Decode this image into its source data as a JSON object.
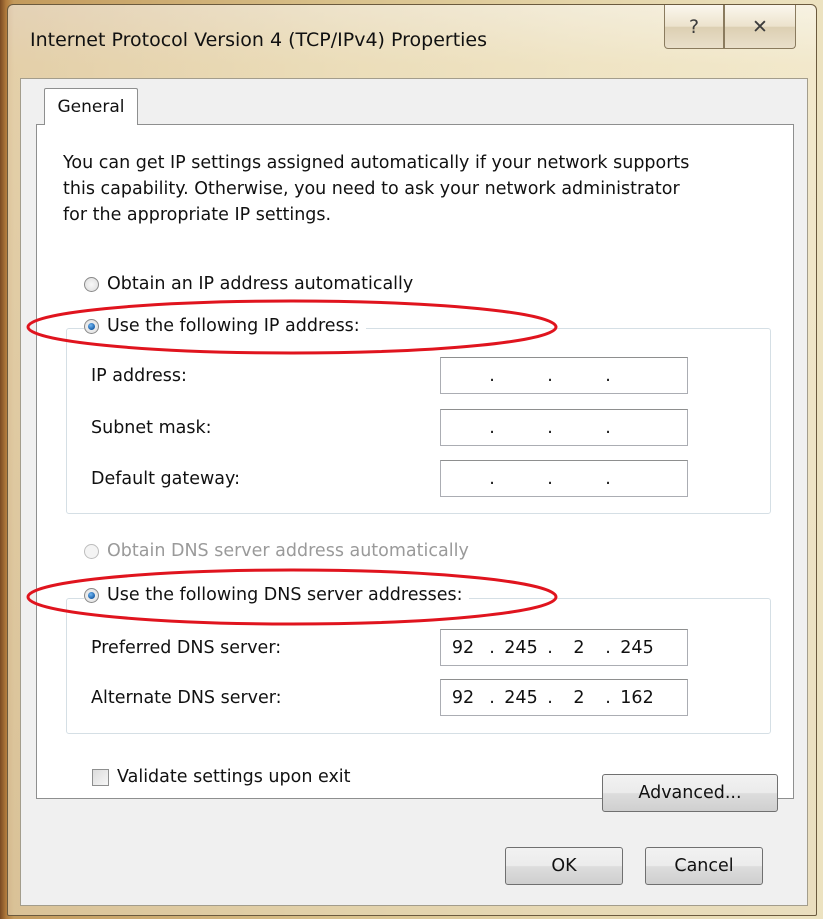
{
  "window": {
    "title": "Internet Protocol Version 4 (TCP/IPv4) Properties",
    "help_label": "?",
    "close_label": "✕"
  },
  "tabs": [
    {
      "label": "General",
      "selected": true
    }
  ],
  "description": "You can get IP settings assigned automatically if your network supports\nthis capability. Otherwise, you need to ask your network administrator\nfor the appropriate IP settings.",
  "ip_section": {
    "auto_label": "Obtain an IP address automatically",
    "manual_label": "Use the following IP address:",
    "selected": "manual",
    "fields": [
      {
        "label": "IP address:",
        "octets": [
          "",
          "",
          "",
          ""
        ]
      },
      {
        "label": "Subnet mask:",
        "octets": [
          "",
          "",
          "",
          ""
        ]
      },
      {
        "label": "Default gateway:",
        "octets": [
          "",
          "",
          "",
          ""
        ]
      }
    ]
  },
  "dns_section": {
    "auto_label": "Obtain DNS server address automatically",
    "auto_enabled": false,
    "manual_label": "Use the following DNS server addresses:",
    "selected": "manual",
    "fields": [
      {
        "label": "Preferred DNS server:",
        "octets": [
          "92",
          "245",
          "2",
          "245"
        ]
      },
      {
        "label": "Alternate DNS server:",
        "octets": [
          "92",
          "245",
          "2",
          "162"
        ]
      }
    ]
  },
  "validate": {
    "label": "Validate settings upon exit",
    "checked": false
  },
  "buttons": {
    "advanced": "Advanced...",
    "ok": "OK",
    "cancel": "Cancel"
  },
  "annotation_color": "#e0141e"
}
